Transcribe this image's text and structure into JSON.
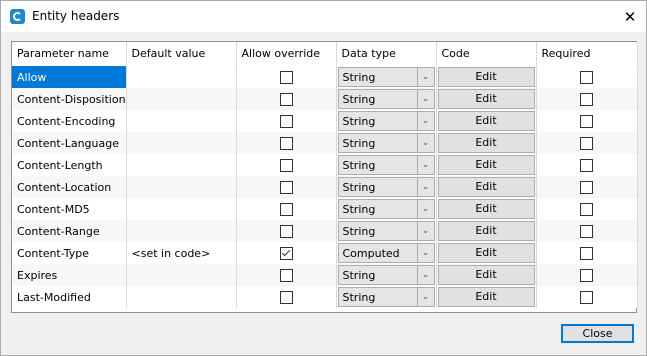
{
  "window": {
    "title": "Entity headers"
  },
  "columns": [
    "Parameter name",
    "Default value",
    "Allow override",
    "Data type",
    "Code",
    "Required"
  ],
  "rows": [
    {
      "name": "Allow",
      "default": "",
      "override": false,
      "type": "String",
      "code": "Edit",
      "required": false,
      "selected": true
    },
    {
      "name": "Content-Disposition",
      "default": "",
      "override": false,
      "type": "String",
      "code": "Edit",
      "required": false
    },
    {
      "name": "Content-Encoding",
      "default": "",
      "override": false,
      "type": "String",
      "code": "Edit",
      "required": false
    },
    {
      "name": "Content-Language",
      "default": "",
      "override": false,
      "type": "String",
      "code": "Edit",
      "required": false
    },
    {
      "name": "Content-Length",
      "default": "",
      "override": false,
      "type": "String",
      "code": "Edit",
      "required": false
    },
    {
      "name": "Content-Location",
      "default": "",
      "override": false,
      "type": "String",
      "code": "Edit",
      "required": false
    },
    {
      "name": "Content-MD5",
      "default": "",
      "override": false,
      "type": "String",
      "code": "Edit",
      "required": false
    },
    {
      "name": "Content-Range",
      "default": "",
      "override": false,
      "type": "String",
      "code": "Edit",
      "required": false
    },
    {
      "name": "Content-Type",
      "default": "<set in code>",
      "override": true,
      "type": "Computed",
      "code": "Edit",
      "required": false
    },
    {
      "name": "Expires",
      "default": "",
      "override": false,
      "type": "String",
      "code": "Edit",
      "required": false
    },
    {
      "name": "Last-Modified",
      "default": "",
      "override": false,
      "type": "String",
      "code": "Edit",
      "required": false
    }
  ],
  "footer": {
    "close_label": "Close"
  },
  "icons": {
    "app": "app-logo-icon",
    "close": "close-icon",
    "dropdown": "chevron-down-icon"
  },
  "colors": {
    "selection": "#0078d7",
    "button_focus": "#0078d7"
  }
}
